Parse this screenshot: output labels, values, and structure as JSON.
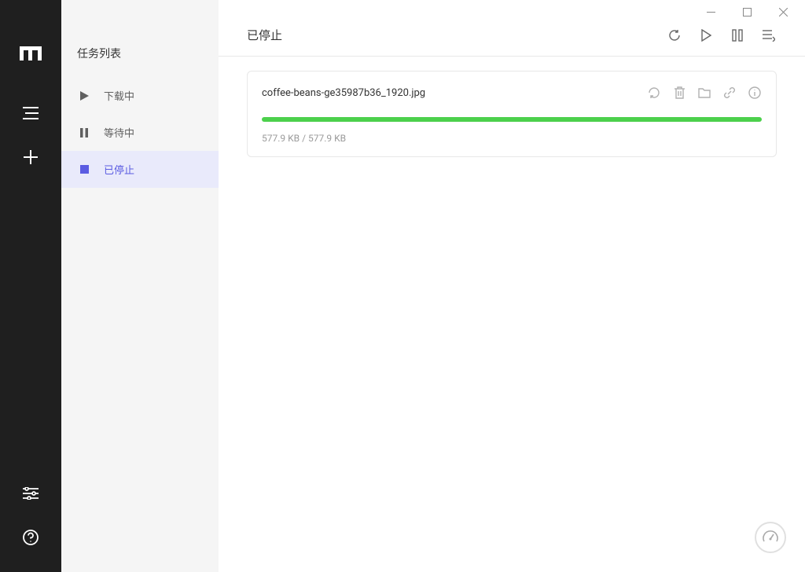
{
  "sidebar": {
    "section_title": "任务列表",
    "items": [
      {
        "label": "下载中"
      },
      {
        "label": "等待中"
      },
      {
        "label": "已停止"
      }
    ]
  },
  "header": {
    "title": "已停止"
  },
  "task": {
    "name": "coffee-beans-ge35987b36_1920.jpg",
    "size_text": "577.9 KB / 577.9 KB",
    "progress_percent": 100
  }
}
